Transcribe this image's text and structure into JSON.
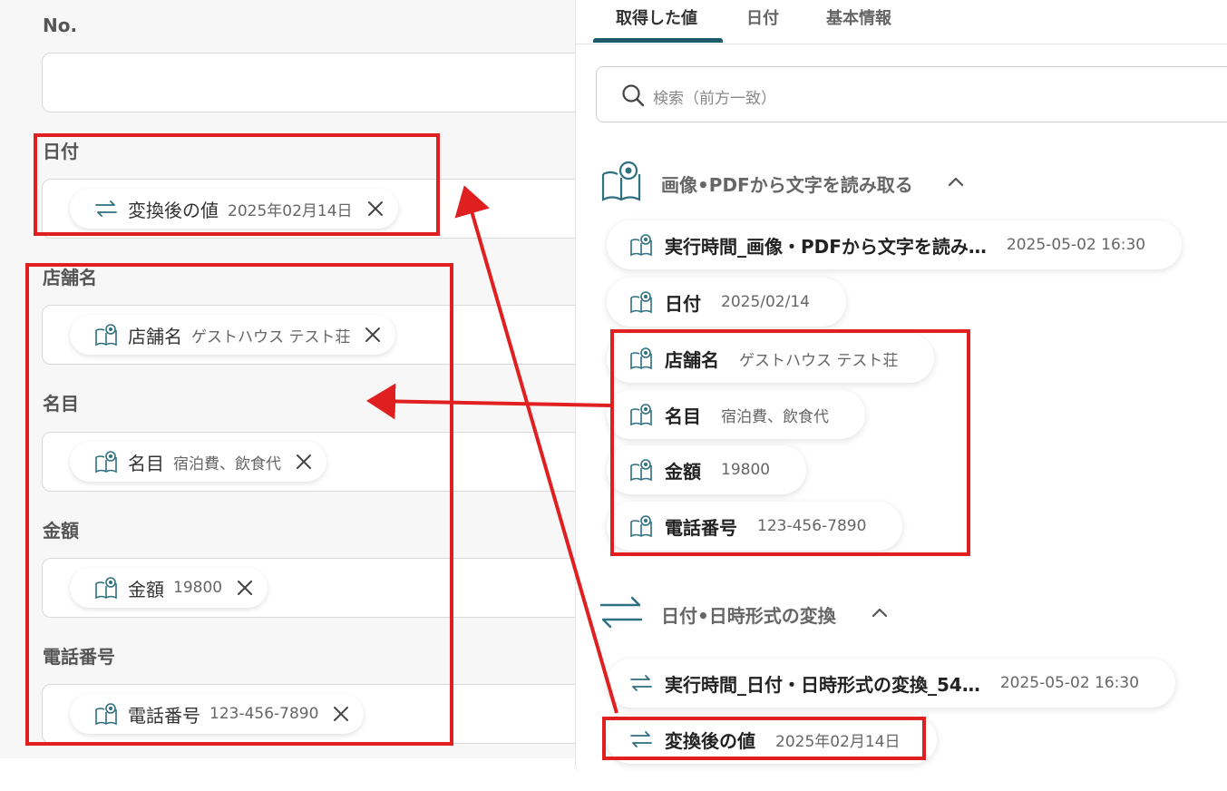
{
  "form": {
    "fields": [
      {
        "label": "No.",
        "chip": null
      },
      {
        "label": "日付",
        "chip": {
          "icon": "convert-icon",
          "name": "変換後の値",
          "value": "2025年02月14日"
        }
      },
      {
        "label": "店舗名",
        "chip": {
          "icon": "ocr-book-icon",
          "name": "店舗名",
          "value": "ゲストハウス テスト荘"
        }
      },
      {
        "label": "名目",
        "chip": {
          "icon": "ocr-book-icon",
          "name": "名目",
          "value": "宿泊費、飲食代"
        }
      },
      {
        "label": "金額",
        "chip": {
          "icon": "ocr-book-icon",
          "name": "金額",
          "value": "19800"
        }
      },
      {
        "label": "電話番号",
        "chip": {
          "icon": "ocr-book-icon",
          "name": "電話番号",
          "value": "123-456-7890"
        }
      }
    ]
  },
  "panel": {
    "tabs": [
      {
        "label": "取得した値",
        "active": true
      },
      {
        "label": "日付",
        "active": false
      },
      {
        "label": "基本情報",
        "active": false
      }
    ],
    "search_placeholder": "検索（前方一致）",
    "sections": [
      {
        "title": "画像•PDFから文字を読み取る",
        "icon": "ocr-book-icon",
        "items": [
          {
            "label": "実行時間_画像・PDFから文字を読み…",
            "value": "2025-05-02 16:30"
          },
          {
            "label": "日付",
            "value": "2025/02/14"
          },
          {
            "label": "店舗名",
            "value": "ゲストハウス テスト荘"
          },
          {
            "label": "名目",
            "value": "宿泊費、飲食代"
          },
          {
            "label": "金額",
            "value": "19800"
          },
          {
            "label": "電話番号",
            "value": "123-456-7890"
          }
        ]
      },
      {
        "title": "日付•日時形式の変換",
        "icon": "convert-icon",
        "items": [
          {
            "label": "実行時間_日付・日時形式の変換_54…",
            "value": "2025-05-02 16:30"
          },
          {
            "label": "変換後の値",
            "value": "2025年02月14日"
          }
        ]
      }
    ]
  },
  "colors": {
    "accent": "#1d5a6b",
    "annotation": "#e02020",
    "icon": "#2e6f80"
  }
}
